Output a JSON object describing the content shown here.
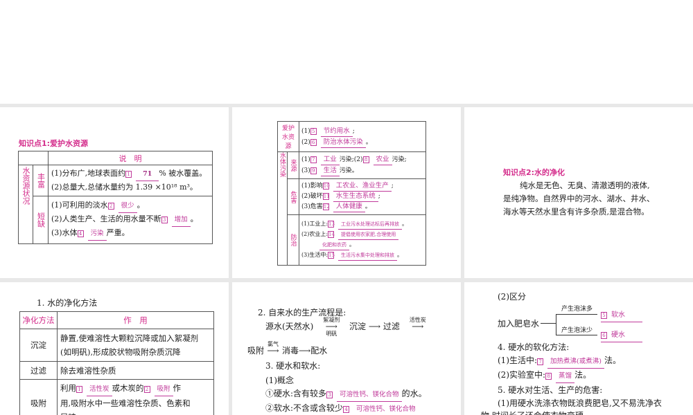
{
  "s1": {
    "title": "知识点1:爱护水资源",
    "header": "说　明",
    "row_label": "水资源状况",
    "rich": {
      "label": "丰富",
      "l1a": "(1)分布广,地球表面约",
      "l1n": "1",
      "l1v": "71",
      "l1b": "% 被水覆盖。",
      "l2": "(2)总量大,总储水量约为 1.39 ×10¹⁸ m³。"
    },
    "short": {
      "label": "短缺",
      "l1a": "(1)可利用的淡水",
      "l1n": "2",
      "l1v": "很少",
      "l1b": "。",
      "l2a": "(2)人类生产、生活的用水量不断",
      "l2n": "3",
      "l2v": "增加",
      "l2b": "。",
      "l3a": "(3)水体",
      "l3n": "4",
      "l3v": "污染",
      "l3b": "严重。"
    }
  },
  "s2": {
    "protect": {
      "label": "爱护水资源",
      "l1a": "(1)",
      "l1n": "5",
      "l1v": "节约用水",
      "l1b": ";",
      "l2a": "(2)",
      "l2n": "6",
      "l2v": "防治水体污染",
      "l2b": "。"
    },
    "pollution_label": "水体污染",
    "source": {
      "label": "来源",
      "a": "(1)",
      "n7": "7",
      "v7": "工业",
      "b": "污染;(2)",
      "n8": "8",
      "v8": "农业",
      "c": "污染;",
      "d": "(3)",
      "n9": "9",
      "v9": "生活",
      "e": "污染。"
    },
    "harm": {
      "label": "危害",
      "l1a": "(1)影响",
      "l1n": "10",
      "l1v": "工农业、渔业生产",
      "l1b": ";",
      "l2a": "(2)破坏",
      "l2n": "11",
      "l2v": "水生生态系统",
      "l2b": ";",
      "l3a": "(3)危害",
      "l3n": "12",
      "l3v": "人体健康",
      "l3b": "。"
    },
    "prevent": {
      "label": "防治",
      "l1a": "(1)工业上:",
      "l1n": "13",
      "l1v": "工业污水处理达标后再排放",
      "l1b": "。",
      "l2a": "(2)农业上:",
      "l2n": "14",
      "l2v": "提倡使用农家肥,合理使用",
      "l2c": "化肥和农药",
      "l2b": "。",
      "l3a": "(3)生活中:",
      "l3n": "15",
      "l3v": "生活污水集中处理和排放",
      "l3b": "。"
    }
  },
  "s3": {
    "title": "知识点2:水的净化",
    "p1": "纯水是无色、无臭、清澈透明的液体,",
    "p2": "是纯净物。自然界中的河水、湖水、井水、",
    "p3": "海水等天然水里含有许多杂质,是混合物。"
  },
  "s4": {
    "heading": "1. 水的净化方法",
    "h1": "净化方法",
    "h2": "作　用",
    "rows": [
      {
        "m": "沉淀",
        "d1": "静置,使难溶性大颗粒沉降或加入絮凝剂",
        "d2": "(如明矾),形成胶状物吸附杂质沉降"
      },
      {
        "m": "过滤",
        "d1": "除去难溶性杂质"
      },
      {
        "m": "吸附",
        "a": "利用",
        "n1": "1",
        "v1": "活性炭",
        "b": "或木炭的",
        "n2": "2",
        "v2": "吸附",
        "c": "作",
        "d2": "用,吸附水中一些难溶性杂质、色素和",
        "d3": "异味"
      }
    ]
  },
  "s5": {
    "heading": "2. 自来水的生产流程是:",
    "f1": "源水(天然水)",
    "f1t": "絮凝剂",
    "f1b": "明矾",
    "f2": "沉淀",
    "f3": "过滤",
    "f3t": "活性炭",
    "f4": "吸附",
    "f4t": "氯气",
    "f5": "消毒",
    "f6": "配水",
    "h3": "3. 硬水和软水:",
    "c1": "(1)概念",
    "hard_a": "①硬水:含有较多",
    "n3": "3",
    "v3": "可溶性钙、镁化合物",
    "hard_b": "的水。",
    "soft_a": "②软水:不含或含较少",
    "n4": "4",
    "v4": "可溶性钙、镁化合物"
  },
  "s6": {
    "c2": "(2)区分",
    "soap": "加入肥皂水",
    "more": "产生泡沫多",
    "n5": "5",
    "v5": "软水",
    "less": "产生泡沫少",
    "n6": "6",
    "v6": "硬水",
    "h4": "4. 硬水的软化方法:",
    "l1a": "(1)生活中:",
    "n7": "7",
    "v7": "加热煮沸(或煮沸)",
    "l1b": "法。",
    "l2a": "(2)实验室中:",
    "n8": "8",
    "v8": "蒸馏",
    "l2b": "法。",
    "h5": "5. 硬水对生活、生产的危害:",
    "p1": "(1)用硬水洗涤衣物既浪费肥皂,又不易洗净衣",
    "p2": "物,时间长了还会使衣物变硬。"
  }
}
